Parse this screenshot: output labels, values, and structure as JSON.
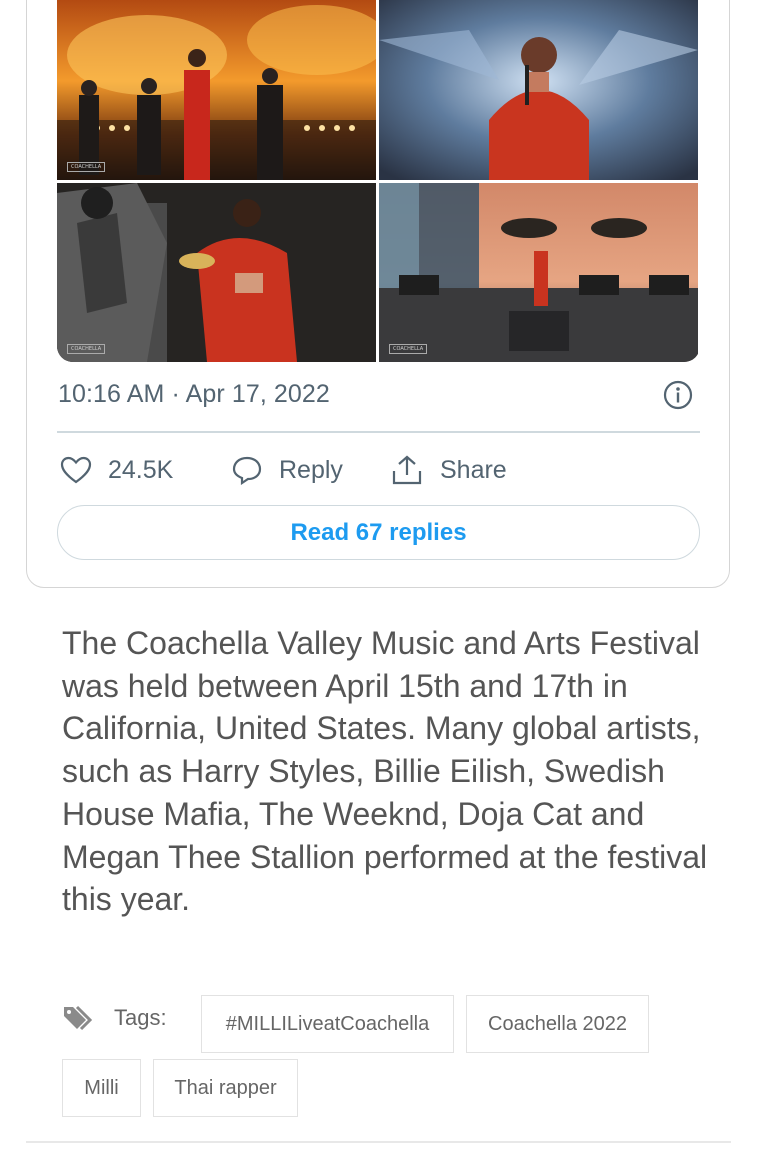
{
  "tweet": {
    "timestamp": "10:16 AM · Apr 17, 2022",
    "likes": "24.5K",
    "reply_label": "Reply",
    "share_label": "Share",
    "read_replies": "Read 67 replies",
    "media": [
      {
        "alt": "Performer in red on stage with flames and dancers",
        "logo": "COACHELLA"
      },
      {
        "alt": "Performer in red outfit with sparkling backdrop"
      },
      {
        "alt": "Performer in red holding a bowl beside dancer",
        "logo": "COACHELLA"
      },
      {
        "alt": "Wide stage shot with close-up face on screen",
        "logo": "COACHELLA"
      }
    ],
    "icons": {
      "like": "heart-icon",
      "reply": "speech-bubble-icon",
      "share": "share-upload-icon",
      "info": "info-circle-icon"
    }
  },
  "article": {
    "body": "The Coachella Valley Music and Arts Festival was held between April 15th and 17th in California, United States. Many global artists, such as Harry Styles, Billie Eilish, Swedish House Mafia, The Weeknd, Doja Cat and Megan Thee Stallion performed at the festival this year."
  },
  "tags": {
    "label": "Tags:",
    "icon": "tag-icon",
    "items": [
      "#MILLILiveatCoachella",
      "Coachella 2022",
      "Milli",
      "Thai rapper"
    ]
  },
  "colors": {
    "accent": "#1d9bf0",
    "muted": "#536471",
    "text": "#555555"
  }
}
